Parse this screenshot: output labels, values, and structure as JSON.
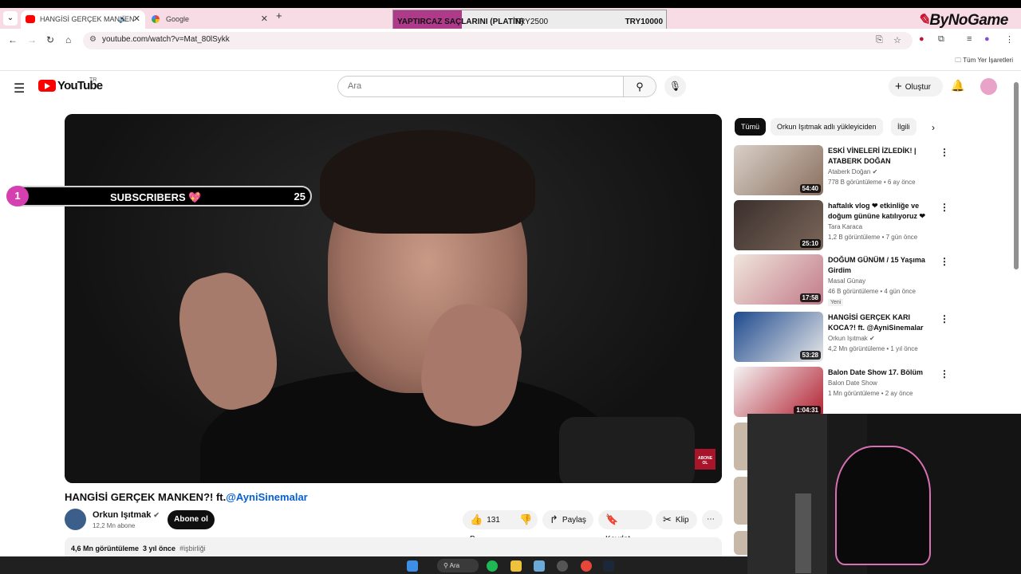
{
  "browser": {
    "tabs": [
      {
        "label": "HANGİSİ GERÇEK MANKEN",
        "active": true
      },
      {
        "label": "Google",
        "active": false
      }
    ],
    "url": "youtube.com/watch?v=Mat_80lSykk",
    "bookmarks_label": "Tüm Yer İşaretleri"
  },
  "overlay": {
    "donation_title": "YAPTIRCAZ SAÇLARINI (PLATİN)",
    "donation_current": "TRY2500",
    "donation_goal": "TRY10000",
    "donation_progress": 0.25,
    "brand": "ByNoGame",
    "subs_goal_number": "1",
    "subs_goal_label": "SUBSCRIBERS 💖",
    "subs_goal_count": "25"
  },
  "youtube": {
    "logo_text": "YouTube",
    "country": "TR",
    "search_placeholder": "Ara",
    "create_label": "Oluştur"
  },
  "video": {
    "title": "HANGİSİ GERÇEK MANKEN?! ft.",
    "title_mention": "@AyniSinemalar",
    "channel": "Orkun Işıtmak",
    "subscribers": "12,2 Mn abone",
    "subscribe_label": "Abone ol",
    "likes": "131 B",
    "share_label": "Paylaş",
    "save_label": "Kaydet",
    "clip_label": "Klip",
    "views": "4,6 Mn görüntüleme",
    "age": "3 yıl önce",
    "hashtag": "#işbirliği",
    "end_tag": "ABONE OL"
  },
  "sidebar": {
    "chips": [
      "Tümü",
      "Orkun Işıtmak adlı yükleyiciden",
      "İlgili"
    ],
    "recommendations": [
      {
        "title": "ESKİ VİNELERİ İZLEDİK! | ATABERK DOĞAN",
        "channel": "Ataberk Doğan",
        "meta": "778 B görüntüleme • 6 ay önce",
        "duration": "54:40",
        "verified": true,
        "badge": ""
      },
      {
        "title": "haftalık vlog ❤ etkinliğe ve doğum gününe katılıyoruz ❤",
        "channel": "Tara Karaca",
        "meta": "1,2 B görüntüleme • 7 gün önce",
        "duration": "25:10",
        "verified": false,
        "badge": ""
      },
      {
        "title": "DOĞUM GÜNÜM / 15 Yaşıma Girdim",
        "channel": "Masal Günay",
        "meta": "46 B görüntüleme • 4 gün önce",
        "duration": "17:58",
        "verified": false,
        "badge": "Yeni"
      },
      {
        "title": "HANGİSİ GERÇEK KARI KOCA?! ft. @AyniSinemalar",
        "channel": "Orkun Işıtmak",
        "meta": "4,2 Mn görüntüleme • 1 yıl önce",
        "duration": "53:28",
        "verified": true,
        "badge": ""
      },
      {
        "title": "Balon Date Show 17. Bölüm",
        "channel": "Balon Date Show",
        "meta": "1 Mn görüntüleme • 2 ay önce",
        "duration": "1:04:31",
        "verified": false,
        "badge": ""
      }
    ]
  },
  "taskbar": {
    "search_label": "Ara"
  },
  "colors": {
    "accent": "#ff0000",
    "donation_fill": "#b03a8a",
    "subs_pink": "#d63fb0",
    "mention": "#065fd4"
  }
}
